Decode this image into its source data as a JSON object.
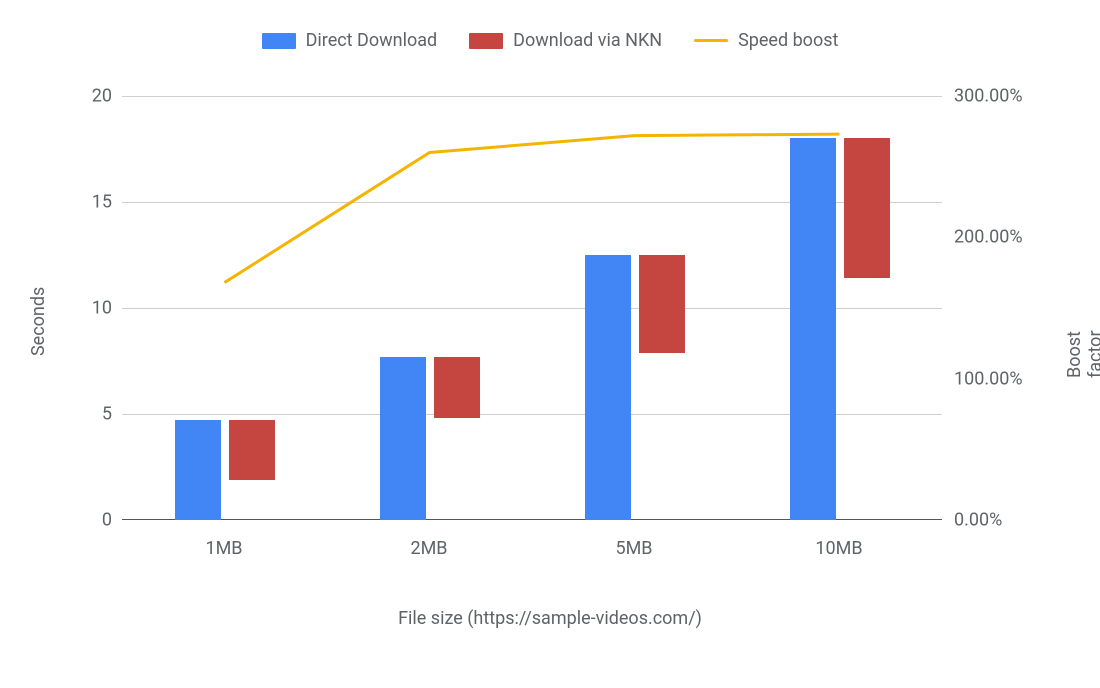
{
  "legend": {
    "direct": "Direct Download",
    "nkn": "Download via NKN",
    "boost": "Speed boost"
  },
  "axes": {
    "yLeftLabel": "Seconds",
    "yRightLabel": "Boost factor %",
    "xLabel": "File size (https://sample-videos.com/)",
    "yLeftTicks": [
      "0",
      "5",
      "10",
      "15",
      "20"
    ],
    "yRightTicks": [
      "0.00%",
      "100.00%",
      "200.00%",
      "300.00%"
    ],
    "xTicks": [
      "1MB",
      "2MB",
      "5MB",
      "10MB"
    ]
  },
  "colors": {
    "blue": "#4285f4",
    "red": "#c54540",
    "yellow": "#f4b400"
  },
  "chart_data": {
    "type": "bar",
    "categories": [
      "1MB",
      "2MB",
      "5MB",
      "10MB"
    ],
    "series": [
      {
        "name": "Direct Download",
        "axis": "left",
        "kind": "bar",
        "values": [
          4.7,
          7.7,
          12.5,
          18.0
        ]
      },
      {
        "name": "Download via NKN",
        "axis": "left",
        "kind": "bar",
        "values": [
          2.8,
          2.9,
          4.6,
          6.6
        ]
      },
      {
        "name": "Speed boost",
        "axis": "right",
        "kind": "line",
        "values": [
          168,
          260,
          272,
          273
        ]
      }
    ],
    "yLeft": {
      "min": 0,
      "max": 20,
      "label": "Seconds"
    },
    "yRight": {
      "min": 0,
      "max": 300,
      "label": "Boost factor %"
    },
    "xlabel": "File size (https://sample-videos.com/)",
    "legend_position": "top",
    "grid": true
  }
}
